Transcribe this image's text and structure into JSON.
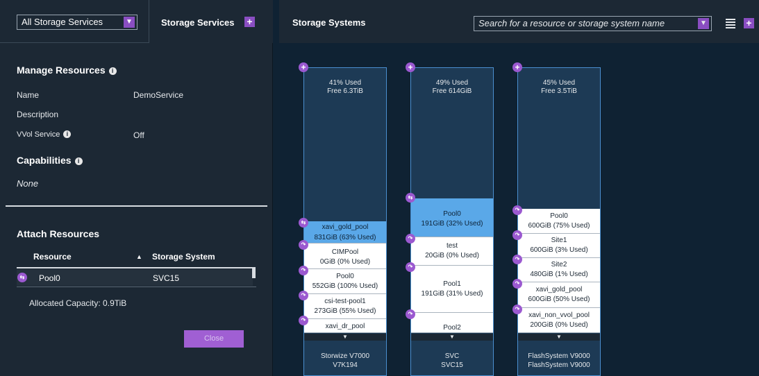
{
  "left": {
    "service_filter": "All Storage Services",
    "services_tab": "Storage Services",
    "manage": {
      "title": "Manage Resources",
      "name_label": "Name",
      "name_value": "DemoService",
      "description_label": "Description",
      "vvol_label": "VVol Service",
      "vvol_value": "Off",
      "capabilities_title": "Capabilities",
      "capabilities_value": "None"
    },
    "attach": {
      "title": "Attach Resources",
      "col_resource": "Resource",
      "col_system": "Storage System",
      "rows": [
        {
          "resource": "Pool0",
          "system": "SVC15"
        }
      ],
      "allocated": "Allocated Capacity: 0.9TiB",
      "close_label": "Close"
    }
  },
  "right": {
    "title": "Storage Systems",
    "search_placeholder": "Search for a resource or storage system name",
    "systems": [
      {
        "used": "41% Used",
        "free": "Free 6.3TiB",
        "pools": [
          {
            "name": "xavi_gold_pool",
            "cap": "831GiB (63% Used)"
          },
          {
            "name": "CIMPool",
            "cap": "0GiB (0% Used)"
          },
          {
            "name": "Pool0",
            "cap": "552GiB (100% Used)"
          },
          {
            "name": "csi-test-pool1",
            "cap": "273GiB (55% Used)"
          },
          {
            "name": "xavi_dr_pool",
            "cap": ""
          }
        ],
        "model": "Storwize V7000",
        "system_name": "V7K194"
      },
      {
        "used": "49% Used",
        "free": "Free 614GiB",
        "pools": [
          {
            "name": "Pool0",
            "cap": "191GiB (32% Used)"
          },
          {
            "name": "test",
            "cap": "20GiB (0% Used)"
          },
          {
            "name": "Pool1",
            "cap": "191GiB (31% Used)"
          },
          {
            "name": "Pool2",
            "cap": ""
          }
        ],
        "model": "SVC",
        "system_name": "SVC15"
      },
      {
        "used": "45% Used",
        "free": "Free 3.5TiB",
        "pools": [
          {
            "name": "Pool0",
            "cap": "600GiB (75% Used)"
          },
          {
            "name": "Site1",
            "cap": "600GiB (3% Used)"
          },
          {
            "name": "Site2",
            "cap": "480GiB (1% Used)"
          },
          {
            "name": "xavi_gold_pool",
            "cap": "600GiB (50% Used)"
          },
          {
            "name": "xavi_non_vvol_pool",
            "cap": "200GiB (0% Used)"
          }
        ],
        "model": "FlashSystem V9000",
        "system_name": "FlashSystem V9000"
      }
    ]
  }
}
